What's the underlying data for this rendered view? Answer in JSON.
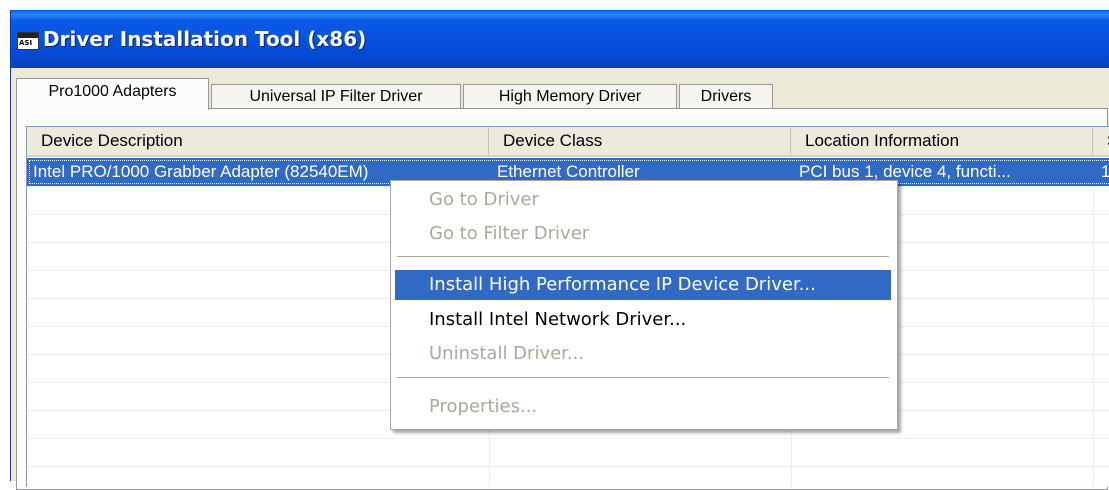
{
  "window": {
    "title": "Driver Installation Tool (x86)",
    "icon_label": "ASI"
  },
  "tabs": [
    {
      "label": "Pro1000 Adapters",
      "active": true
    },
    {
      "label": "Universal IP Filter Driver",
      "active": false
    },
    {
      "label": "High Memory Driver",
      "active": false
    },
    {
      "label": "Drivers",
      "active": false
    }
  ],
  "list": {
    "columns": [
      "Device Description",
      "Device Class",
      "Location Information",
      "S"
    ],
    "rows": [
      {
        "description": "Intel PRO/1000 Grabber Adapter (82540EM)",
        "class": "Ethernet Controller",
        "location": "PCI bus 1, device 4, functi...",
        "extra": "1",
        "selected": true
      }
    ]
  },
  "context_menu": {
    "items": [
      {
        "label": "Go to Driver",
        "enabled": false
      },
      {
        "label": "Go to Filter Driver",
        "enabled": false
      },
      {
        "label": "Install High Performance IP Device Driver...",
        "enabled": true,
        "highlighted": true
      },
      {
        "label": "Install Intel Network Driver...",
        "enabled": true
      },
      {
        "label": "Uninstall Driver...",
        "enabled": false
      },
      {
        "label": "Properties...",
        "enabled": false
      }
    ]
  },
  "colors": {
    "titlebar": "#0a5ae8",
    "selection": "#316ac5",
    "disabled_text": "#aca899"
  }
}
